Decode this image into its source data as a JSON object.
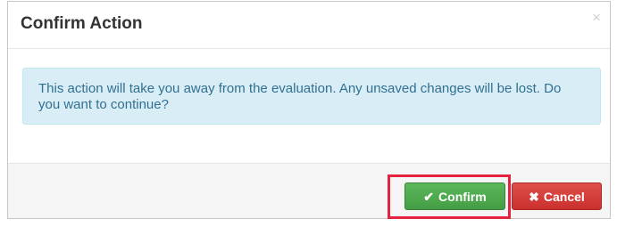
{
  "dialog": {
    "title": "Confirm Action",
    "close_symbol": "×",
    "message": "This action will take you away from the evaluation. Any unsaved changes will be lost. Do you want to continue?",
    "confirm_label": "Confirm",
    "cancel_label": "Cancel"
  },
  "icons": {
    "confirm": "checkmark-icon",
    "cancel": "x-icon"
  },
  "colors": {
    "confirm_button": "#5cb85c",
    "cancel_button": "#d9534f",
    "alert_background": "#d9edf7",
    "alert_text": "#31708f",
    "highlight_outline": "#e3233f"
  }
}
